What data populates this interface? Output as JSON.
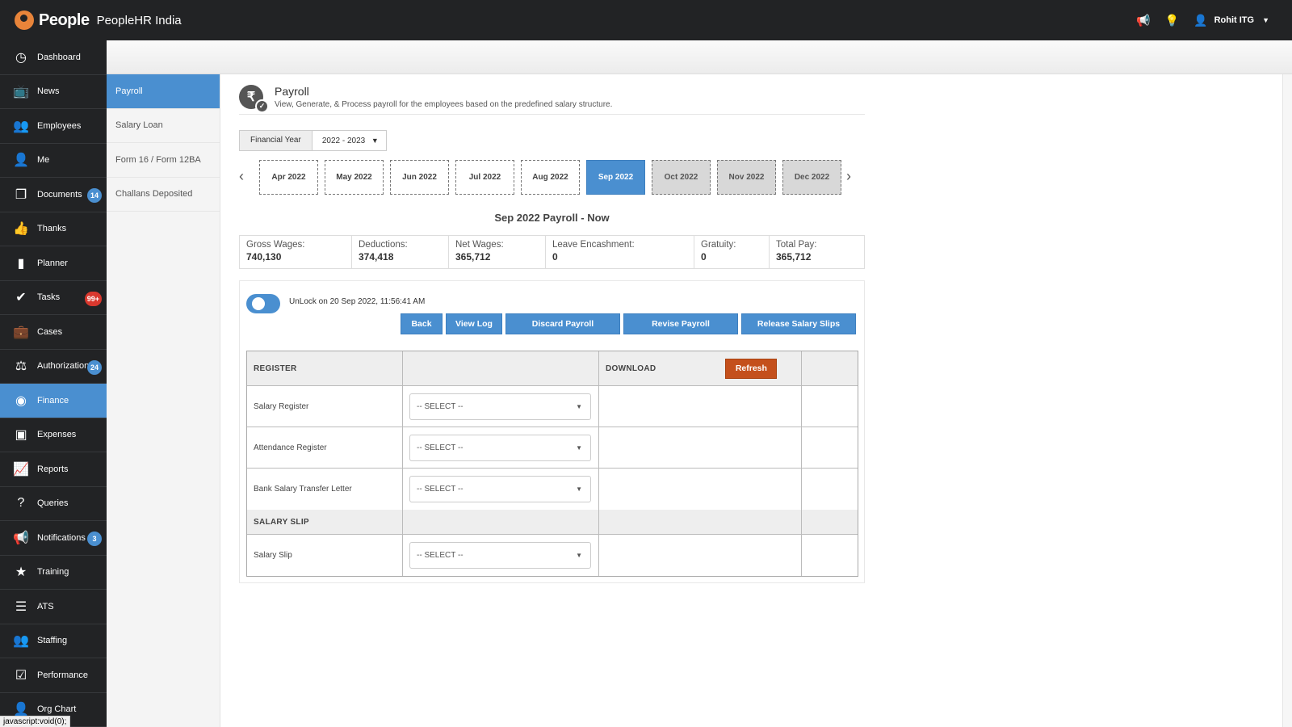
{
  "app": {
    "brand": "People",
    "company": "PeopleHR India",
    "user": "Rohit ITG",
    "status_text": "javascript:void(0);"
  },
  "nav": [
    {
      "label": "Dashboard",
      "icon": "dashboard-icon",
      "glyph": "◷"
    },
    {
      "label": "News",
      "icon": "tv-icon",
      "glyph": "📺"
    },
    {
      "label": "Employees",
      "icon": "users-icon",
      "glyph": "👥"
    },
    {
      "label": "Me",
      "icon": "user-gear-icon",
      "glyph": "👤"
    },
    {
      "label": "Documents",
      "icon": "documents-icon",
      "glyph": "❐",
      "badge": "14"
    },
    {
      "label": "Thanks",
      "icon": "thumbs-up-icon",
      "glyph": "👍"
    },
    {
      "label": "Planner",
      "icon": "planner-icon",
      "glyph": "▮"
    },
    {
      "label": "Tasks",
      "icon": "check-icon",
      "glyph": "✔",
      "badge": "99+",
      "badge_color": "red"
    },
    {
      "label": "Cases",
      "icon": "briefcase-icon",
      "glyph": "💼"
    },
    {
      "label": "Authorizations",
      "icon": "gavel-icon",
      "glyph": "⚖",
      "badge": "24"
    },
    {
      "label": "Finance",
      "icon": "coins-icon",
      "glyph": "◉",
      "active": true
    },
    {
      "label": "Expenses",
      "icon": "wallet-icon",
      "glyph": "▣"
    },
    {
      "label": "Reports",
      "icon": "chart-icon",
      "glyph": "📈"
    },
    {
      "label": "Queries",
      "icon": "question-icon",
      "glyph": "?"
    },
    {
      "label": "Notifications",
      "icon": "megaphone-icon",
      "glyph": "📢",
      "badge": "3"
    },
    {
      "label": "Training",
      "icon": "star-icon",
      "glyph": "★"
    },
    {
      "label": "ATS",
      "icon": "list-icon",
      "glyph": "☰"
    },
    {
      "label": "Staffing",
      "icon": "staffing-icon",
      "glyph": "👥"
    },
    {
      "label": "Performance",
      "icon": "checkbox-icon",
      "glyph": "☑"
    },
    {
      "label": "Org Chart",
      "icon": "org-chart-icon",
      "glyph": "👤"
    }
  ],
  "submenu": [
    {
      "label": "Payroll",
      "active": true
    },
    {
      "label": "Salary Loan"
    },
    {
      "label": "Form 16 / Form 12BA"
    },
    {
      "label": "Challans Deposited"
    }
  ],
  "page": {
    "title": "Payroll",
    "description": "View, Generate, & Process payroll for the employees based on the predefined salary structure.",
    "fy_label": "Financial Year",
    "fy_value": "2022 - 2023",
    "months": [
      {
        "label": "Apr 2022",
        "state": "past"
      },
      {
        "label": "May 2022",
        "state": "past"
      },
      {
        "label": "Jun 2022",
        "state": "past"
      },
      {
        "label": "Jul 2022",
        "state": "past"
      },
      {
        "label": "Aug 2022",
        "state": "past"
      },
      {
        "label": "Sep 2022",
        "state": "active"
      },
      {
        "label": "Oct 2022",
        "state": "future"
      },
      {
        "label": "Nov 2022",
        "state": "future"
      },
      {
        "label": "Dec 2022",
        "state": "future"
      }
    ],
    "period_title": "Sep 2022 Payroll - Now",
    "summary": [
      {
        "label": "Gross Wages:",
        "value": "740,130"
      },
      {
        "label": "Deductions:",
        "value": "374,418"
      },
      {
        "label": "Net Wages:",
        "value": "365,712"
      },
      {
        "label": "Leave Encashment:",
        "value": "0"
      },
      {
        "label": "Gratuity:",
        "value": "0"
      },
      {
        "label": "Total Pay:",
        "value": "365,712"
      }
    ],
    "lock_text": "UnLock on 20 Sep 2022, 11:56:41 AM",
    "actions": [
      "Back",
      "View Log",
      "Discard Payroll",
      "Revise Payroll",
      "Release Salary Slips"
    ],
    "table": {
      "register_header": "REGISTER",
      "download_header": "DOWNLOAD",
      "refresh_label": "Refresh",
      "select_placeholder": "-- SELECT --",
      "register_rows": [
        "Salary Register",
        "Attendance Register",
        "Bank Salary Transfer Letter"
      ],
      "slip_header": "SALARY SLIP",
      "slip_rows": [
        "Salary Slip"
      ]
    }
  }
}
